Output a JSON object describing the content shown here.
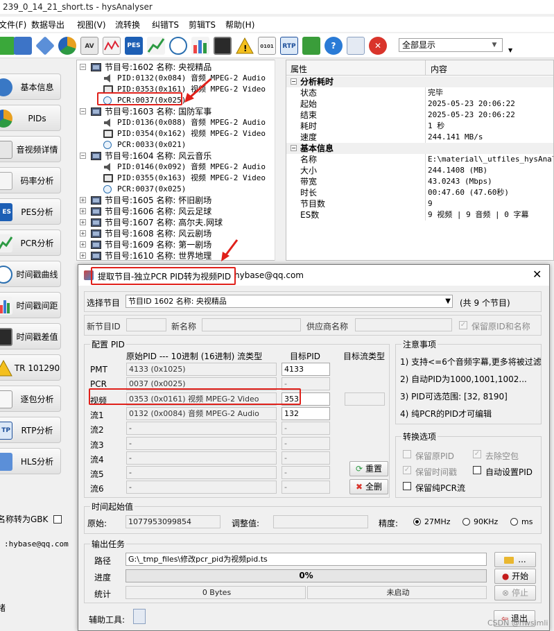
{
  "window": {
    "title": "239_0_14_21_short.ts - hysAnalyser"
  },
  "menu": [
    {
      "label": "文件(F)"
    },
    {
      "label": "数据导出"
    },
    {
      "label": "视图(V)"
    },
    {
      "label": "流转换"
    },
    {
      "label": "纠错TS"
    },
    {
      "label": "剪辑TS"
    },
    {
      "label": "帮助(H)"
    }
  ],
  "toolbar": {
    "icons": [
      "add-icon",
      "network-icon",
      "diamond-icon",
      "pie-icon",
      "av-icon",
      "wave-icon",
      "pes-icon",
      "line-icon",
      "clock-icon",
      "bar-chart-icon",
      "monitor-icon",
      "warning-icon",
      "binary-icon",
      "rtp-icon",
      "export-icon",
      "help-icon",
      "list-icon",
      "stop-icon"
    ],
    "pes_text": "PES",
    "rtp_text": "RTP",
    "av_text": "AV",
    "bin_text": "0101",
    "display_select": "全部显示"
  },
  "sidebar": {
    "items": [
      {
        "label": "基本信息"
      },
      {
        "label": "PIDs"
      },
      {
        "label": "音视频详情"
      },
      {
        "label": "码率分析"
      },
      {
        "label": "PES分析"
      },
      {
        "label": "PCR分析"
      },
      {
        "label": "时间戳曲线"
      },
      {
        "label": "时间戳间距"
      },
      {
        "label": "时间戳差值"
      },
      {
        "label": "TR 101290"
      },
      {
        "label": "逐包分析"
      },
      {
        "label": "RTP分析"
      },
      {
        "label": "HLS分析"
      }
    ],
    "pes_badge": "ES",
    "rtp_badge": "TP",
    "tr_badge": "TR",
    "gbk_label": "名称转为GBK",
    "email": ":hybase@qq.com",
    "bottom_char": "绪"
  },
  "tree": {
    "programs": [
      {
        "label": "节目号:1602 名称: 央视精品",
        "expanded": true,
        "children": [
          {
            "type": "audio",
            "label": "PID:0132(0x084) 音频 MPEG-2 Audio"
          },
          {
            "type": "video",
            "label": "PID:0353(0x161) 视频 MPEG-2 Video"
          },
          {
            "type": "pcr",
            "label": "PCR:0037(0x025)"
          }
        ]
      },
      {
        "label": "节目号:1603 名称: 国防军事",
        "expanded": true,
        "children": [
          {
            "type": "audio",
            "label": "PID:0136(0x088) 音频 MPEG-2 Audio"
          },
          {
            "type": "video",
            "label": "PID:0354(0x162) 视频 MPEG-2 Video"
          },
          {
            "type": "pcr",
            "label": "PCR:0033(0x021)"
          }
        ]
      },
      {
        "label": "节目号:1604 名称: 风云音乐",
        "expanded": true,
        "children": [
          {
            "type": "audio",
            "label": "PID:0146(0x092) 音频 MPEG-2 Audio"
          },
          {
            "type": "video",
            "label": "PID:0355(0x163) 视频 MPEG-2 Video"
          },
          {
            "type": "pcr",
            "label": "PCR:0037(0x025)"
          }
        ]
      },
      {
        "label": "节目号:1605 名称: 怀旧剧场",
        "expanded": false,
        "children": []
      },
      {
        "label": "节目号:1606 名称: 风云足球",
        "expanded": false,
        "children": []
      },
      {
        "label": "节目号:1607 名称: 高尔夫.网球",
        "expanded": false,
        "children": []
      },
      {
        "label": "节目号:1608 名称: 风云剧场",
        "expanded": false,
        "children": []
      },
      {
        "label": "节目号:1609 名称: 第一剧场",
        "expanded": false,
        "children": []
      },
      {
        "label": "节目号:1610 名称: 世界地理",
        "expanded": false,
        "children": []
      }
    ]
  },
  "props": {
    "header_property": "属性",
    "header_content": "内容",
    "sections": [
      {
        "title": "分析耗时",
        "rows": [
          {
            "key": "状态",
            "value": "完毕"
          },
          {
            "key": "起始",
            "value": "2025-05-23 20:06:22"
          },
          {
            "key": "结束",
            "value": "2025-05-23 20:06:22"
          },
          {
            "key": "耗时",
            "value": "1 秒"
          },
          {
            "key": "速度",
            "value": "244.141 MB/s"
          }
        ]
      },
      {
        "title": "基本信息",
        "rows": [
          {
            "key": "名称",
            "value": "E:\\material\\_utfiles_hysAnalyser"
          },
          {
            "key": "大小",
            "value": "244.1408 (MB)"
          },
          {
            "key": "带宽",
            "value": "43.0243 (Mbps)"
          },
          {
            "key": "时长",
            "value": "00:47.60 (47.60秒)"
          },
          {
            "key": "节目数",
            "value": "9"
          },
          {
            "key": "ES数",
            "value": "9 视频 | 9 音频 | 0 字幕"
          }
        ]
      }
    ]
  },
  "dialog": {
    "title": "提取节目-独立PCR PID转为视频PID",
    "title_suffix": "hybase@qq.com",
    "select_program_label": "选择节目",
    "select_program_value": "节目ID 1602 名称: 央视精品",
    "program_count": "(共 9 个节目)",
    "new_program_id_label": "新节目ID",
    "new_name_label": "新名称",
    "provider_label": "供应商名称",
    "keep_original_label": "保留原ID和名称",
    "keep_original_checked": true,
    "config_title": "配置 PID",
    "col_src": "原始PID --- 10进制 (16进制) 流类型",
    "col_dst": "目标PID",
    "col_type": "目标流类型",
    "pid_rows": [
      {
        "label": "PMT",
        "src": "4133 (0x1025)",
        "dst": "4133",
        "enabled": true
      },
      {
        "label": "PCR",
        "src": "0037 (0x0025)",
        "dst": "-",
        "enabled": false
      },
      {
        "label": "视频",
        "src": "0353 (0x0161) 视频 MPEG-2 Video",
        "dst": "353",
        "enabled": true
      },
      {
        "label": "流1",
        "src": "0132 (0x0084) 音频 MPEG-2 Audio",
        "dst": "132",
        "enabled": true
      },
      {
        "label": "流2",
        "src": "-",
        "dst": "-",
        "enabled": false
      },
      {
        "label": "流3",
        "src": "-",
        "dst": "-",
        "enabled": false
      },
      {
        "label": "流4",
        "src": "-",
        "dst": "-",
        "enabled": false
      },
      {
        "label": "流5",
        "src": "-",
        "dst": "-",
        "enabled": false
      },
      {
        "label": "流6",
        "src": "-",
        "dst": "-",
        "enabled": false
      }
    ],
    "reset_button": "重置",
    "clear_button": "全删",
    "notes_title": "注意事项",
    "notes": [
      "1) 支持<=6个音频字幕,更多将被过滤",
      "2) 自动PID为1000,1001,1002...",
      "3) PID可选范围: [32, 8190]",
      "4) 纯PCR的PID才可编辑"
    ],
    "convert_title": "转换选项",
    "options": [
      {
        "label": "保留原PID",
        "checked": false,
        "disabled": true
      },
      {
        "label": "去除空包",
        "checked": true,
        "disabled": true
      },
      {
        "label": "保留时间戳",
        "checked": true,
        "disabled": true
      },
      {
        "label": "自动设置PID",
        "checked": false,
        "disabled": false
      },
      {
        "label": "保留纯PCR流",
        "checked": false,
        "disabled": false
      }
    ],
    "time_title": "时间起始值",
    "original_label": "原始:",
    "original_value": "1077953099854",
    "adjust_label": "调整值:",
    "precision_label": "精度:",
    "precision_options": [
      "27MHz",
      "90KHz",
      "ms"
    ],
    "precision_selected": 0,
    "output_title": "输出任务",
    "path_label": "路径",
    "path_value": "G:\\_tmp_files\\修改pcr_pid为视频pid.ts",
    "browse_button": "...",
    "progress_label": "进度",
    "progress_text": "0%",
    "progress_value": 0,
    "start_button": "开始",
    "stats_label": "统计",
    "stats_bytes": "0 Bytes",
    "stats_status": "未启动",
    "stop_button": "停止",
    "tools_label": "辅助工具:",
    "exit_button": "退出",
    "watermark": "CSDN @hwsimli"
  },
  "colors": {
    "annotation_red": "#e0201a",
    "accent_blue": "#1f6fc4"
  }
}
